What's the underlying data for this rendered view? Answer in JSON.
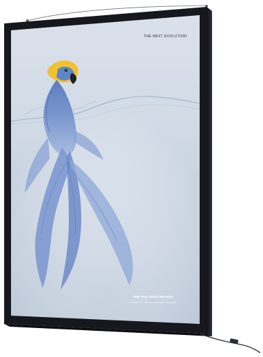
{
  "poster": {
    "headline": "THE NEXT EVOLUTION",
    "footer_title": "Help Stop Global Warming",
    "footer_credit": "Creative Ad • Pictures. All Rights Reserved"
  },
  "colors": {
    "frame": "#1a1c22",
    "poster_top": "#e7ecf3",
    "poster_bottom": "#c7d2df",
    "parrot_blue": "#6f8cc4",
    "parrot_yellow": "#f2c22e",
    "water_line": "#9fb3cc"
  },
  "icons": {
    "parrot": "parrot-fish-illustration",
    "hanger": "hanging-wire",
    "cable": "power-cable"
  }
}
